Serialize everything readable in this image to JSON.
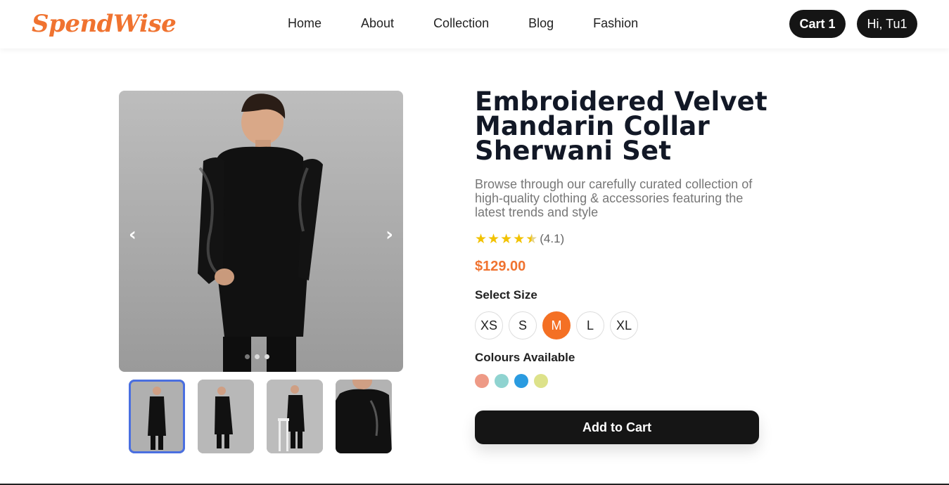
{
  "header": {
    "logo": "SpendWise",
    "nav": [
      "Home",
      "About",
      "Collection",
      "Blog",
      "Fashion"
    ],
    "cart_label": "Cart 1",
    "user_label": "Hi, Tu1"
  },
  "gallery": {
    "prev_icon": "‹",
    "next_icon": "›",
    "image_count": 3,
    "active_index": 0,
    "thumbnail_count": 4,
    "selected_thumbnail": 0
  },
  "product": {
    "title": "Embroidered Velvet Mandarin Collar Sherwani Set",
    "description": "Browse through our carefully curated collection of high-quality clothing & accessories featuring the latest trends and style",
    "rating_value": 4.1,
    "rating_text": "(4.1)",
    "price": "$129.00",
    "select_size_label": "Select Size",
    "sizes": [
      "XS",
      "S",
      "M",
      "L",
      "XL"
    ],
    "selected_size": "M",
    "colours_label": "Colours Available",
    "colours": [
      "#ee9a86",
      "#8fd3d0",
      "#2a9be0",
      "#dde28a"
    ],
    "add_to_cart_label": "Add to Cart"
  },
  "colors": {
    "brand": "#f07330",
    "dark": "#151515",
    "star": "#f2c200",
    "thumb_border": "#4a6fe0"
  }
}
